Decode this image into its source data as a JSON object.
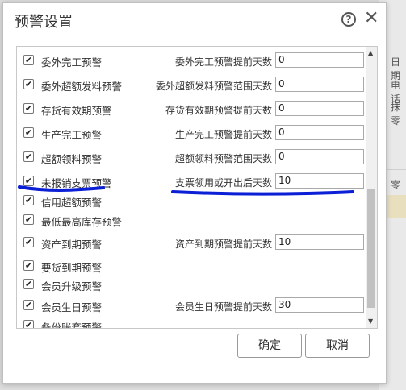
{
  "dialog": {
    "title": "预警设置",
    "help_icon_glyph": "?",
    "close_icon_glyph": "✕",
    "ok_label": "确定",
    "cancel_label": "取消"
  },
  "background": {
    "labels": [
      "日期",
      "电话",
      "抹零"
    ],
    "header_label": "零"
  },
  "warnings": [
    {
      "label": "委外完工预警",
      "checked": true,
      "field_label": "委外完工预警提前天数",
      "value": "0"
    },
    {
      "label": "委外超额发料预警",
      "checked": true,
      "field_label": "委外超额发料预警范围天数",
      "value": "0"
    },
    {
      "label": "存货有效期预警",
      "checked": true,
      "field_label": "存货有效期预警提前天数",
      "value": "0"
    },
    {
      "label": "生产完工预警",
      "checked": true,
      "field_label": "生产完工预警提前天数",
      "value": "0"
    },
    {
      "label": "超额领料预警",
      "checked": true,
      "field_label": "超额领料预警范围天数",
      "value": "0"
    },
    {
      "label": "未报销支票预警",
      "checked": true,
      "field_label": "支票领用或开出后天数",
      "value": "10"
    },
    {
      "label": "信用超额预警",
      "checked": true,
      "field_label": "",
      "value": ""
    },
    {
      "label": "最低最高库存预警",
      "checked": true,
      "field_label": "",
      "value": ""
    },
    {
      "label": "资产到期预警",
      "checked": true,
      "field_label": "资产到期预警提前天数",
      "value": "10"
    },
    {
      "label": "要货到期预警",
      "checked": true,
      "field_label": "",
      "value": ""
    },
    {
      "label": "会员升级预警",
      "checked": true,
      "field_label": "",
      "value": ""
    },
    {
      "label": "会员生日预警",
      "checked": true,
      "field_label": "会员生日预警提前天数",
      "value": "30"
    },
    {
      "label": "备份账套预警",
      "checked": true,
      "field_label": "",
      "value": ""
    }
  ],
  "colors": {
    "annotation_blue": "#0a1fd6",
    "scroll_thumb": "#c1c1c1"
  }
}
